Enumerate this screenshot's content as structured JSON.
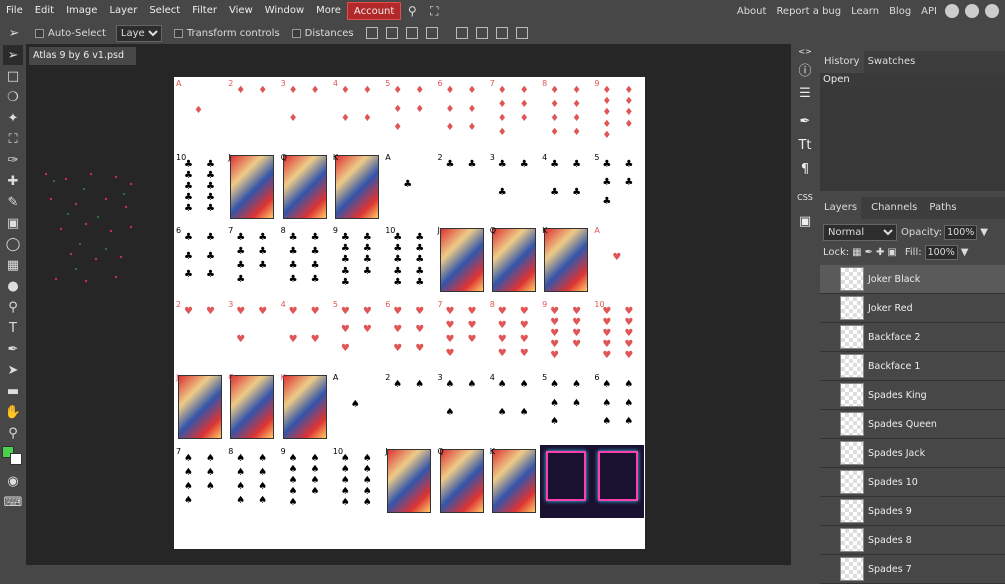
{
  "menubar": {
    "items": [
      "File",
      "Edit",
      "Image",
      "Layer",
      "Select",
      "Filter",
      "View",
      "Window",
      "More"
    ],
    "account_label": "Account",
    "right_links": [
      "About",
      "Report a bug",
      "Learn",
      "Blog",
      "API"
    ]
  },
  "options": {
    "auto_select_label": "Auto-Select",
    "select_value": "Layer",
    "transform_label": "Transform controls",
    "distances_label": "Distances"
  },
  "document": {
    "tab_title": "Atlas 9 by 6 v1.psd"
  },
  "history": {
    "tabs": [
      "History",
      "Swatches"
    ],
    "items": [
      "Open"
    ]
  },
  "layers_panel": {
    "tabs": [
      "Layers",
      "Channels",
      "Paths"
    ],
    "blend_mode": "Normal",
    "opacity_label": "Opacity:",
    "opacity_value": "100%",
    "lock_label": "Lock:",
    "fill_label": "Fill:",
    "fill_value": "100%",
    "layers": [
      "Joker Black",
      "Joker Red",
      "Backface 2",
      "Backface 1",
      "Spades King",
      "Spades Queen",
      "Spades Jack",
      "Spades 10",
      "Spades 9",
      "Spades 8",
      "Spades 7"
    ]
  },
  "colors": {
    "foreground": "#4bd14b",
    "background": "#ffffff",
    "accent_menu": "#b32828"
  },
  "canvas_cards": {
    "row1": [
      "A",
      "2",
      "3",
      "4",
      "5",
      "6",
      "7",
      "8",
      "9"
    ],
    "row2": [
      "10",
      "J",
      "Q",
      "K",
      "A",
      "2",
      "3",
      "4",
      "5"
    ],
    "row3": [
      "6",
      "7",
      "8",
      "9",
      "10",
      "J",
      "Q",
      "K",
      "A"
    ],
    "row4": [
      "2",
      "3",
      "4",
      "5",
      "6",
      "7",
      "8",
      "9",
      "10"
    ],
    "row5": [
      "J",
      "Q",
      "K",
      "A",
      "2",
      "3",
      "4",
      "5",
      "6"
    ],
    "row6": [
      "7",
      "8",
      "9",
      "10",
      "J",
      "Q",
      "K",
      "",
      ""
    ]
  }
}
